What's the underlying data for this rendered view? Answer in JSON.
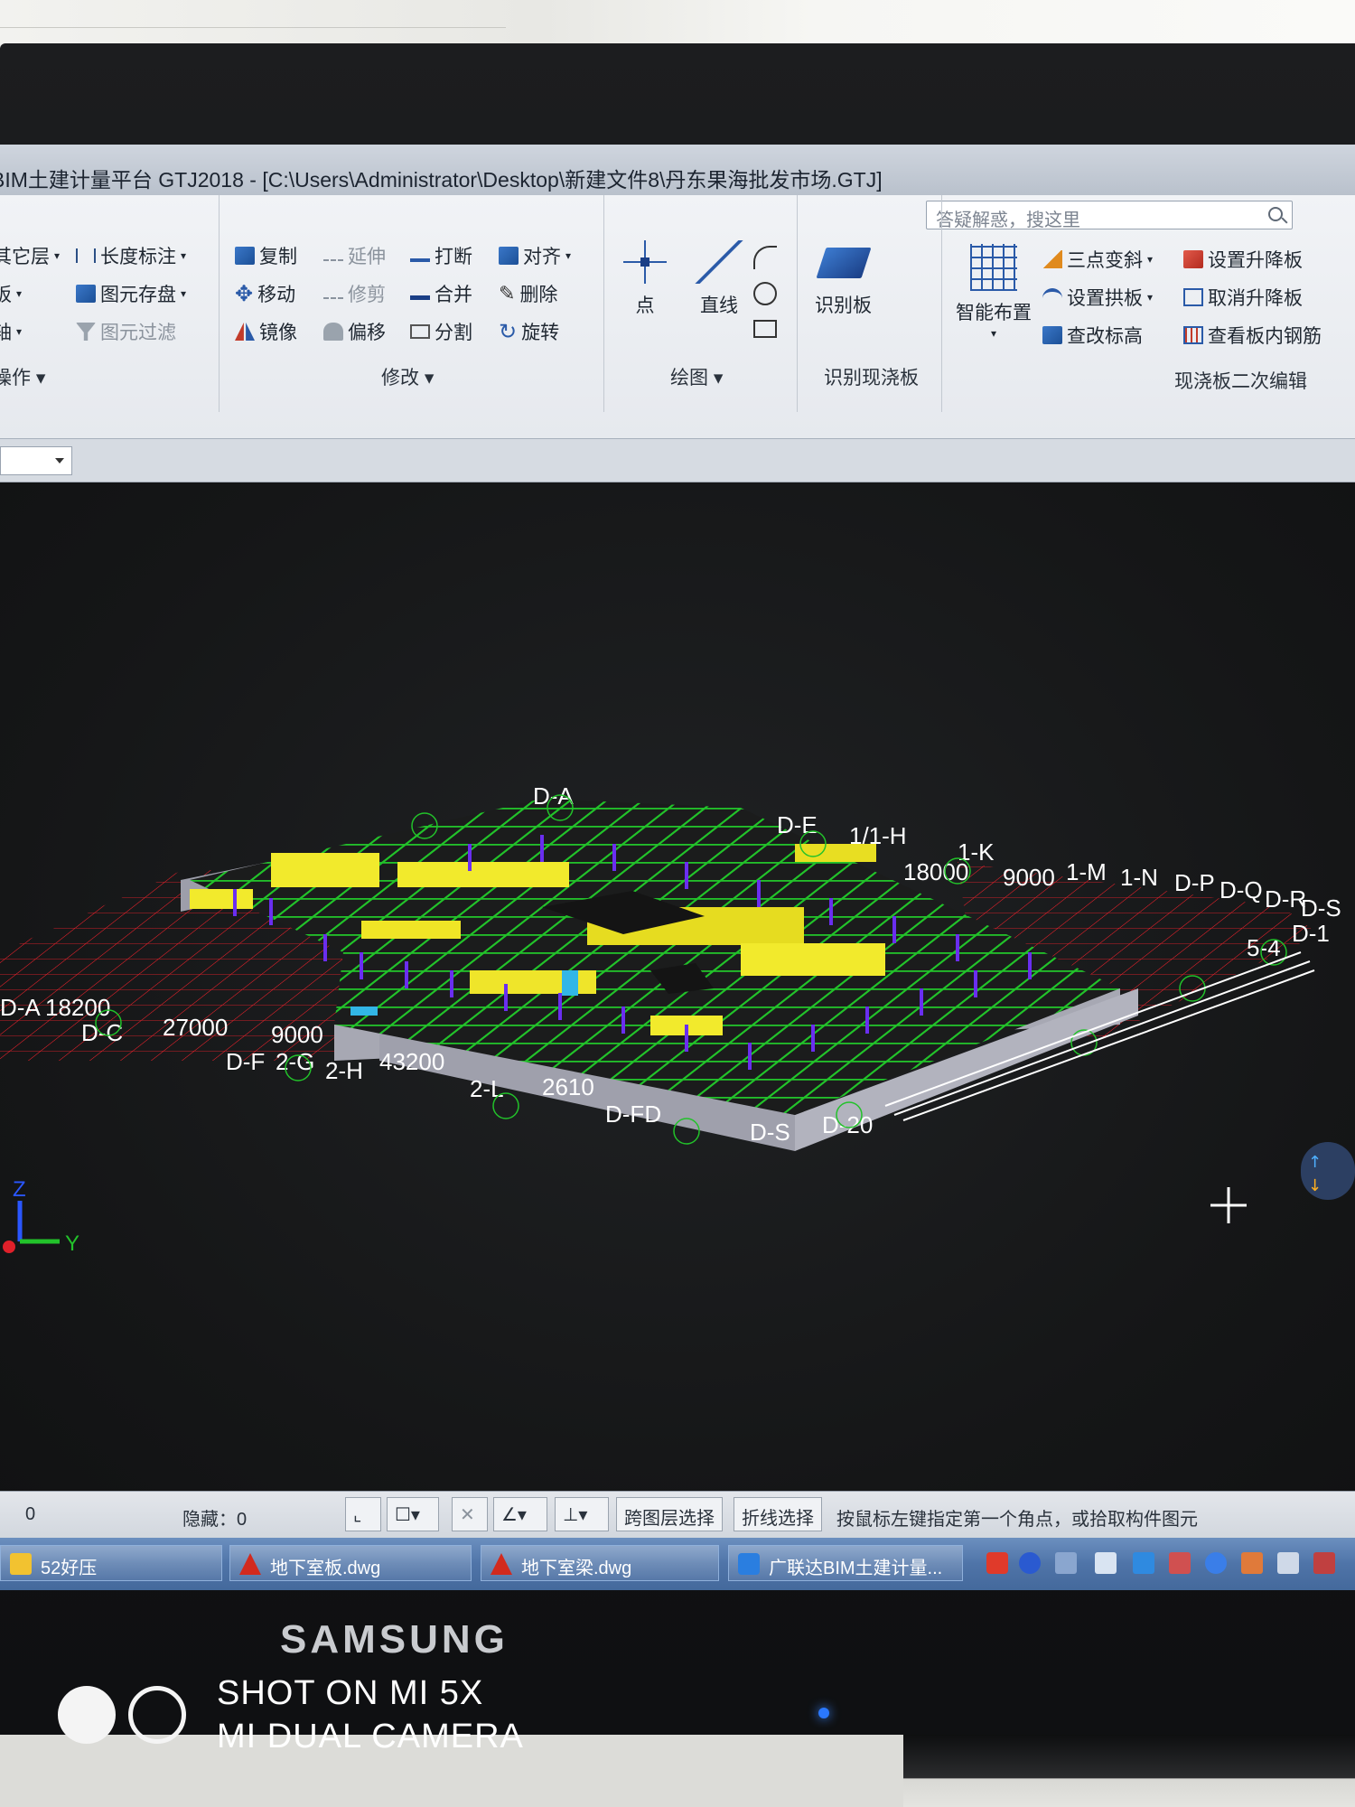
{
  "window": {
    "title": "BIM土建计量平台 GTJ2018 - [C:\\Users\\Administrator\\Desktop\\新建文件8\\丹东果海批发市场.GTJ]",
    "search_placeholder": "答疑解惑，搜这里"
  },
  "ribbon": {
    "left_group": {
      "items": [
        "其它层",
        "长度标注",
        "板",
        "图元存盘",
        "轴",
        "图元过滤"
      ],
      "label": "操作"
    },
    "modify_group": {
      "label": "修改",
      "items": [
        "复制",
        "延伸",
        "打断",
        "对齐",
        "移动",
        "修剪",
        "合并",
        "删除",
        "镜像",
        "偏移",
        "分割",
        "旋转"
      ]
    },
    "draw_group": {
      "label": "绘图",
      "items": [
        "点",
        "直线"
      ]
    },
    "recognize_group": {
      "label": "识别现浇板",
      "button": "识别板"
    },
    "edit_group": {
      "label": "现浇板二次编辑",
      "big_button": "智能布置",
      "items": [
        "三点变斜",
        "设置升降板",
        "设置拱板",
        "取消升降板",
        "查改标高",
        "查看板内钢筋"
      ]
    }
  },
  "viewport": {
    "axis_labels": {
      "z": "Z",
      "y": "Y"
    },
    "model_labels": [
      "D-A",
      "18200",
      "D-C",
      "27000",
      "9000",
      "D-F",
      "2-G",
      "2-H",
      "43200",
      "2-L",
      "2610",
      "D-FD",
      "D-S",
      "D-20",
      "1/1-H",
      "1-K",
      "18000",
      "9000",
      "1-M",
      "1-N",
      "D-P",
      "D-Q",
      "D-R",
      "D-S",
      "5-4",
      "D-1",
      "D-E",
      "D-A"
    ],
    "colors": {
      "background": "#151617",
      "grid": "#e0202a",
      "beams": "#22c22a",
      "walls": "#f2ea2c",
      "columns": "#6a2ef0",
      "slab_edge": "#a7a8b3"
    }
  },
  "statusbar": {
    "left_value": "0",
    "hidden_label": "隐藏：0",
    "cross_layer": "跨图层选择",
    "polyline_select": "折线选择",
    "hint": "按鼠标左键指定第一个角点，或拾取构件图元"
  },
  "taskbar": {
    "items": [
      "52好压",
      "地下室板.dwg",
      "地下室梁.dwg",
      "广联达BIM土建计量..."
    ]
  },
  "monitor": {
    "brand": "SAMSUNG"
  },
  "watermark": {
    "line1": "SHOT ON MI 5X",
    "line2": "MI DUAL CAMERA"
  }
}
